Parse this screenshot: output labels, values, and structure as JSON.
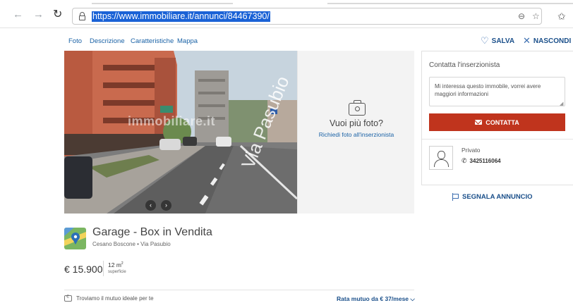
{
  "browser": {
    "url": "https://www.immobiliare.it/annunci/84467390/",
    "back_icon": "arrow-left-icon",
    "forward_icon": "arrow-right-icon",
    "reload_icon": "reload-icon",
    "zoom_icon": "zoom-icon",
    "reading_icon": "reading-view-icon",
    "favorites_icon": "favorites-star-icon"
  },
  "nav": {
    "links": [
      "Foto",
      "Descrizione",
      "Caratteristiche",
      "Mappa"
    ],
    "save_label": "SALVA",
    "hide_label": "NASCONDI"
  },
  "gallery": {
    "watermark": "immobiliare.it",
    "street_sign": "Via Pasubio",
    "more_title": "Vuoi più foto?",
    "more_link": "Richiedi foto all'inserzionista"
  },
  "contact": {
    "title": "Contatta l'inserzionista",
    "message": "Mi interessa questo immobile, vorrei avere maggiori informazioni",
    "button_label": "CONTATTA",
    "seller_type": "Privato",
    "phone": "3425116064",
    "report_label": "SEGNALA ANNUNCIO"
  },
  "listing": {
    "title": "Garage - Box in Vendita",
    "location": "Cesano Boscone • Via Pasubio",
    "price": "€ 15.900",
    "surface_value": "12 m",
    "surface_unit_sup": "2",
    "surface_label": "superficie"
  },
  "mortgage": {
    "left_text": "Troviamo il mutuo ideale per te",
    "right_text": "Rata mutuo da € 37/mese"
  },
  "colors": {
    "accent_red": "#c0341d",
    "link_blue": "#1a62a6",
    "url_highlight": "#1a62d6"
  }
}
